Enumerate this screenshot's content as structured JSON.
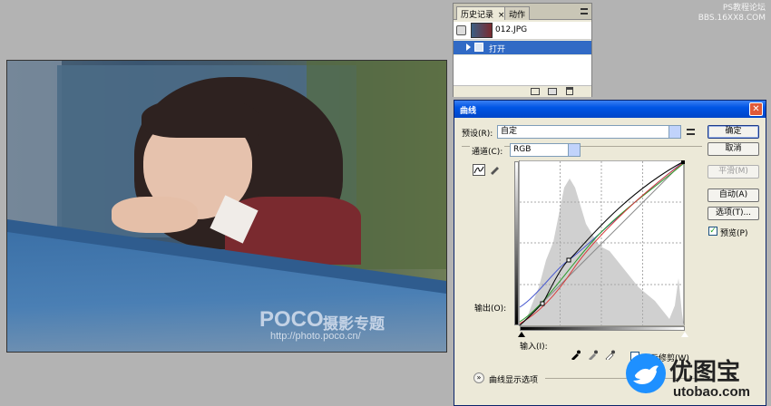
{
  "watermark": {
    "line1": "PS教程论坛",
    "line2": "BBS.16XX8.COM"
  },
  "photo": {
    "brand": "POCO",
    "brand_cn": "摄影专题",
    "url": "http://photo.poco.cn/"
  },
  "history_panel": {
    "tabs": [
      "历史记录",
      "动作"
    ],
    "tab_close": "×",
    "snapshot_name": "012.JPG",
    "step_label": "打开"
  },
  "curves_dialog": {
    "title": "曲线",
    "close_glyph": "✕",
    "preset_label": "预设(R):",
    "preset_value": "自定",
    "channel_label": "通道(C):",
    "channel_value": "RGB",
    "output_label": "输出(O):",
    "input_label": "输入(I):",
    "show_clipping_label": "显示修剪(W)",
    "curve_options_label": "曲线显示选项",
    "buttons": {
      "ok": "确定",
      "cancel": "取消",
      "smooth": "平滑(M)",
      "auto": "自动(A)",
      "options": "选项(T)...",
      "preview": "预览(P)"
    },
    "preview_checked": true
  },
  "logo": {
    "text": "优图宝",
    "sub": "utobao.com"
  }
}
